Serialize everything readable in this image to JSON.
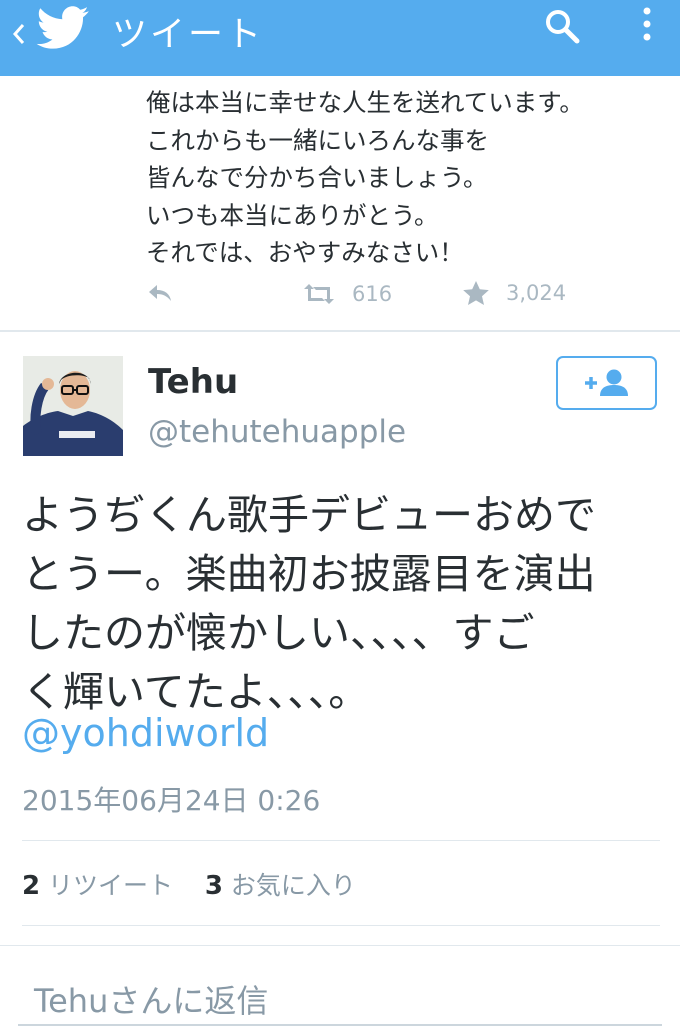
{
  "app": {
    "title": "ツイート",
    "colors": {
      "bar": "#55acee",
      "link": "#55acee",
      "muted": "#8899a6",
      "text": "#292f33"
    },
    "icons": [
      "chevron-left-icon",
      "twitter-bird-icon",
      "search-icon",
      "more-vertical-icon"
    ]
  },
  "previous_tweet": {
    "lines": [
      "俺は本当に幸せな人生を送れています。",
      "これからも一緒にいろんな事を",
      "皆んなで分かち合いましょう。",
      "いつも本当にありがとう。",
      "それでは、おやすみなさい！"
    ],
    "retweet_count": "616",
    "favorite_count": "3,024"
  },
  "tweet": {
    "name": "Tehu",
    "handle": "@tehutehuapple",
    "text_lines": [
      "ようぢくん歌手デビューおめで",
      "とうー。楽曲初お披露目を演出",
      "したのが懐かしい、、、、すご",
      "く輝いてたよ、、、。"
    ],
    "mention": "@yohdiworld",
    "timestamp": "2015年06月24日 0:26",
    "retweets": {
      "count": "2",
      "label": "リツイート"
    },
    "favorites": {
      "count": "3",
      "label": "お気に入り"
    }
  },
  "reply": {
    "placeholder": "Tehuさんに返信"
  }
}
